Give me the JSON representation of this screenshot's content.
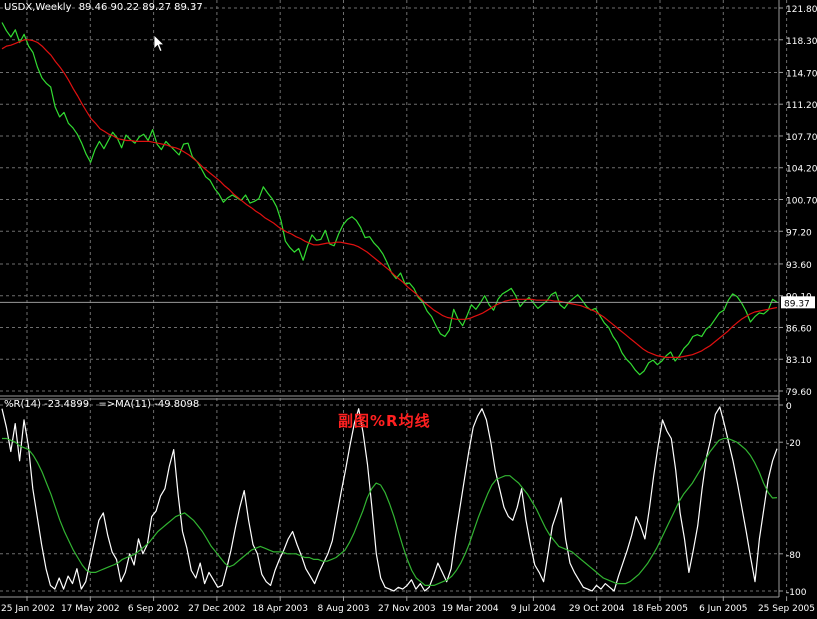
{
  "header": {
    "symbol": "USDX,Weekly",
    "ohlc": "89.46 90.22 89.27 89.37"
  },
  "subpanel": {
    "indicator": "%R(14) -23.4899",
    "ma": "=>MA(11) -49.8098"
  },
  "annotation": "副图%R均线",
  "colors": {
    "background": "#000000",
    "grid": "#6e6e6e",
    "price": "#32dc32",
    "price_ma": "#e01010",
    "wpr": "#ffffff",
    "wpr_ma": "#32b432",
    "axis_text": "#ffffff",
    "annotation": "#ff2020"
  },
  "cursor_icon": "arrow-cursor-icon",
  "chart_data": [
    {
      "type": "line",
      "panel": "main",
      "x": [
        "25 Jan 2002",
        "17 May 2002",
        "6 Sep 2002",
        "27 Dec 2002",
        "18 Apr 2003",
        "8 Aug 2003",
        "27 Nov 2003",
        "19 Mar 2004",
        "9 Jul 2004",
        "29 Oct 2004",
        "18 Feb 2005",
        "6 Jun 2005",
        "25 Sep 2005"
      ],
      "y_ticks": [
        "121.80",
        "118.30",
        "114.70",
        "111.20",
        "107.70",
        "104.20",
        "100.70",
        "97.20",
        "93.60",
        "90.10",
        "86.60",
        "83.10",
        "79.60"
      ],
      "ylim": [
        79.6,
        121.8
      ],
      "current_price_label": "89.37",
      "series": [
        {
          "values": [
            120.2,
            119.3,
            118.6,
            119.4,
            118.0,
            118.9,
            117.6,
            116.9,
            115.3,
            114.1,
            113.5,
            113.1,
            110.9,
            109.8,
            110.3,
            109.1,
            108.6,
            107.9,
            106.9,
            105.7,
            104.8,
            106.2,
            107.1,
            106.3,
            107.2,
            108.1,
            107.5,
            106.4,
            107.8,
            107.3,
            106.9,
            107.6,
            107.9,
            107.2,
            108.4,
            106.8,
            106.2,
            107.1,
            106.6,
            106.1,
            105.6,
            106.8,
            106.9,
            105.4,
            104.9,
            104.1,
            103.2,
            102.8,
            101.9,
            101.3,
            100.4,
            100.9,
            101.2,
            100.9,
            100.6,
            101.2,
            100.3,
            100.5,
            100.8,
            102.1,
            101.4,
            100.8,
            99.9,
            98.4,
            96.1,
            95.4,
            94.9,
            95.3,
            94.0,
            95.6,
            96.8,
            96.2,
            96.3,
            97.3,
            95.8,
            95.6,
            96.9,
            97.9,
            98.5,
            98.8,
            98.4,
            97.6,
            96.5,
            96.6,
            95.9,
            95.4,
            94.7,
            93.7,
            92.6,
            92.0,
            92.6,
            91.4,
            91.5,
            90.9,
            89.9,
            89.4,
            88.4,
            87.8,
            86.8,
            85.9,
            85.6,
            86.3,
            88.6,
            87.5,
            86.8,
            87.9,
            89.1,
            88.6,
            89.3,
            90.1,
            89.1,
            88.5,
            89.7,
            90.3,
            90.6,
            90.9,
            90.1,
            88.9,
            89.5,
            89.9,
            89.3,
            88.7,
            89.1,
            89.5,
            90.2,
            90.5,
            89.1,
            88.7,
            89.4,
            89.8,
            90.2,
            89.6,
            88.9,
            88.5,
            88.7,
            87.9,
            87.1,
            86.6,
            85.6,
            84.9,
            83.8,
            83.1,
            82.6,
            81.9,
            81.4,
            81.8,
            82.7,
            83.0,
            82.5,
            82.9,
            83.5,
            83.9,
            82.9,
            83.5,
            84.3,
            84.8,
            85.6,
            85.8,
            85.6,
            86.4,
            86.8,
            87.5,
            88.2,
            88.5,
            89.6,
            90.3,
            90.0,
            89.3,
            88.4,
            87.2,
            87.8,
            88.2,
            88.1,
            88.5,
            89.7,
            89.37
          ],
          "color": "#32dc32"
        },
        {
          "values": [
            117.3,
            117.6,
            117.7,
            117.9,
            118.1,
            118.3,
            118.3,
            118.2,
            118.0,
            117.6,
            117.1,
            116.6,
            115.9,
            115.3,
            114.6,
            113.8,
            112.9,
            112.1,
            111.2,
            110.4,
            109.6,
            109.1,
            108.5,
            108.2,
            107.9,
            107.7,
            107.4,
            107.3,
            107.2,
            107.2,
            107.1,
            107.1,
            107.1,
            107.1,
            107.0,
            106.9,
            106.8,
            106.7,
            106.5,
            106.4,
            106.2,
            105.9,
            105.6,
            105.2,
            104.8,
            104.3,
            103.9,
            103.5,
            103.1,
            102.7,
            102.2,
            101.8,
            101.3,
            100.9,
            100.5,
            100.1,
            99.8,
            99.4,
            99.1,
            98.7,
            98.4,
            98.1,
            97.7,
            97.4,
            97.1,
            96.9,
            96.6,
            96.4,
            96.1,
            95.9,
            95.7,
            95.7,
            95.8,
            95.9,
            95.9,
            96.0,
            96.0,
            95.9,
            95.8,
            95.7,
            95.5,
            95.2,
            94.9,
            94.5,
            94.1,
            93.7,
            93.3,
            92.9,
            92.4,
            92.0,
            91.6,
            91.1,
            90.7,
            90.3,
            89.8,
            89.3,
            88.9,
            88.5,
            88.2,
            87.9,
            87.7,
            87.6,
            87.5,
            87.5,
            87.5,
            87.6,
            87.8,
            88.0,
            88.2,
            88.5,
            88.8,
            89.1,
            89.3,
            89.5,
            89.6,
            89.7,
            89.7,
            89.7,
            89.7,
            89.7,
            89.6,
            89.6,
            89.6,
            89.6,
            89.5,
            89.5,
            89.4,
            89.3,
            89.2,
            89.1,
            89.0,
            88.8,
            88.6,
            88.4,
            88.1,
            87.8,
            87.4,
            87.0,
            86.6,
            86.2,
            85.8,
            85.4,
            85.0,
            84.6,
            84.2,
            83.9,
            83.7,
            83.5,
            83.4,
            83.3,
            83.3,
            83.3,
            83.3,
            83.4,
            83.5,
            83.6,
            83.8,
            84.0,
            84.3,
            84.6,
            85.0,
            85.4,
            85.8,
            86.2,
            86.7,
            87.1,
            87.5,
            87.8,
            88.1,
            88.3,
            88.4,
            88.5,
            88.6,
            88.7,
            88.8
          ],
          "color": "#e01010"
        }
      ]
    },
    {
      "type": "line",
      "panel": "sub",
      "y_ticks": [
        "0",
        "-20",
        "-80",
        "-100"
      ],
      "ylim": [
        -100,
        0
      ],
      "series": [
        {
          "values": [
            -2,
            -12,
            -25,
            -10,
            -30,
            -8,
            -22,
            -45,
            -60,
            -75,
            -88,
            -97,
            -99,
            -93,
            -99,
            -92,
            -96,
            -88,
            -99,
            -95,
            -84,
            -73,
            -62,
            -58,
            -70,
            -79,
            -83,
            -95,
            -90,
            -80,
            -86,
            -72,
            -80,
            -75,
            -60,
            -57,
            -49,
            -45,
            -33,
            -24,
            -48,
            -68,
            -77,
            -89,
            -93,
            -85,
            -96,
            -90,
            -94,
            -98,
            -97,
            -88,
            -78,
            -66,
            -55,
            -46,
            -62,
            -75,
            -80,
            -91,
            -95,
            -97,
            -89,
            -83,
            -78,
            -72,
            -68,
            -75,
            -81,
            -88,
            -92,
            -96,
            -90,
            -85,
            -80,
            -73,
            -60,
            -47,
            -35,
            -22,
            -10,
            -2,
            -15,
            -32,
            -55,
            -80,
            -93,
            -98,
            -99,
            -100,
            -98,
            -99,
            -97,
            -94,
            -99,
            -96,
            -100,
            -98,
            -92,
            -85,
            -90,
            -95,
            -88,
            -70,
            -55,
            -40,
            -25,
            -12,
            -6,
            -2,
            -8,
            -20,
            -35,
            -45,
            -55,
            -60,
            -62,
            -55,
            -45,
            -62,
            -75,
            -86,
            -90,
            -95,
            -80,
            -65,
            -58,
            -50,
            -72,
            -85,
            -90,
            -94,
            -98,
            -99,
            -100,
            -97,
            -99,
            -96,
            -98,
            -100,
            -92,
            -85,
            -78,
            -70,
            -60,
            -65,
            -72,
            -56,
            -38,
            -22,
            -8,
            -14,
            -18,
            -35,
            -58,
            -72,
            -90,
            -78,
            -65,
            -45,
            -28,
            -18,
            -5,
            -1,
            -10,
            -20,
            -30,
            -42,
            -55,
            -68,
            -82,
            -95,
            -72,
            -56,
            -40,
            -30,
            -23.49
          ],
          "color": "#ffffff"
        },
        {
          "values": [
            -18,
            -18,
            -19,
            -20,
            -22,
            -23,
            -24,
            -27,
            -31,
            -36,
            -42,
            -48,
            -55,
            -62,
            -68,
            -73,
            -78,
            -82,
            -86,
            -89,
            -90,
            -90,
            -89,
            -88,
            -87,
            -86,
            -85,
            -83,
            -82,
            -81,
            -80,
            -78,
            -76,
            -74,
            -71,
            -68,
            -66,
            -64,
            -62,
            -60,
            -59,
            -58,
            -60,
            -62,
            -65,
            -68,
            -72,
            -76,
            -79,
            -82,
            -85,
            -87,
            -86,
            -84,
            -82,
            -80,
            -78,
            -77,
            -76,
            -77,
            -78,
            -79,
            -79,
            -79,
            -80,
            -80,
            -80,
            -81,
            -82,
            -82,
            -83,
            -83,
            -84,
            -84,
            -83,
            -82,
            -80,
            -78,
            -74,
            -69,
            -63,
            -57,
            -50,
            -45,
            -42,
            -43,
            -47,
            -53,
            -60,
            -68,
            -76,
            -83,
            -89,
            -93,
            -95,
            -97,
            -97,
            -97,
            -96,
            -95,
            -94,
            -92,
            -89,
            -85,
            -80,
            -74,
            -67,
            -60,
            -54,
            -48,
            -43,
            -40,
            -39,
            -38,
            -38,
            -40,
            -42,
            -45,
            -48,
            -52,
            -56,
            -61,
            -66,
            -70,
            -73,
            -76,
            -77,
            -78,
            -79,
            -81,
            -83,
            -85,
            -87,
            -89,
            -91,
            -93,
            -94,
            -95,
            -96,
            -96,
            -96,
            -95,
            -93,
            -91,
            -88,
            -85,
            -81,
            -77,
            -72,
            -67,
            -62,
            -57,
            -52,
            -48,
            -45,
            -42,
            -38,
            -34,
            -29,
            -25,
            -22,
            -19,
            -18,
            -18,
            -19,
            -20,
            -22,
            -24,
            -27,
            -31,
            -36,
            -42,
            -47,
            -50,
            -49.81
          ],
          "color": "#32b432"
        }
      ]
    }
  ]
}
